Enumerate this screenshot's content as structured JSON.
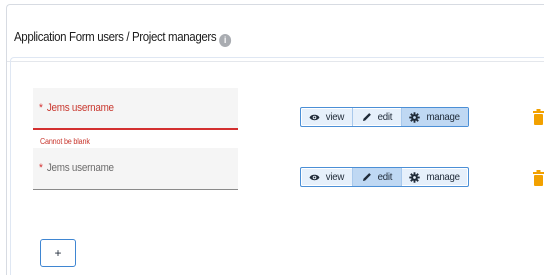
{
  "header": {
    "title": "Application Form users / Project managers",
    "info_icon": "info-icon"
  },
  "rows": [
    {
      "field": {
        "required_mark": "*",
        "label": "Jems username",
        "value": "",
        "state": "invalid"
      },
      "error": "Cannot be blank",
      "permissions": {
        "options": [
          "view",
          "edit",
          "manage"
        ],
        "selected": "manage"
      }
    },
    {
      "field": {
        "required_mark": "*",
        "label": "Jems username",
        "value": "",
        "state": "normal"
      },
      "error": "",
      "permissions": {
        "options": [
          "view",
          "edit",
          "manage"
        ],
        "selected": "edit"
      }
    }
  ],
  "add_button": {
    "label": "+"
  },
  "colors": {
    "accent": "#3f86d2",
    "error": "#d32f2f",
    "delete": "#f2a100"
  }
}
